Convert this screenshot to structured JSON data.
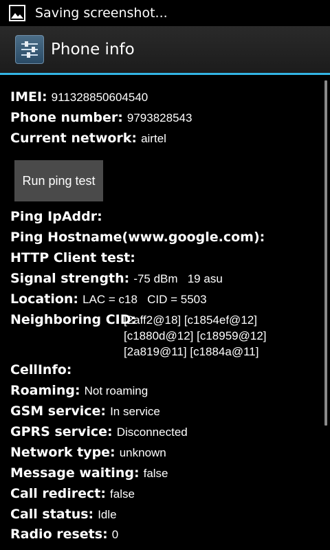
{
  "status_bar": {
    "icon": "image-icon",
    "text": "Saving screenshot..."
  },
  "action_bar": {
    "icon": "settings-sliders-icon",
    "title": "Phone info"
  },
  "info": {
    "imei": {
      "label": "IMEI:",
      "value": "911328850604540"
    },
    "phone_number": {
      "label": "Phone number:",
      "value": "9793828543"
    },
    "current_network": {
      "label": "Current network:",
      "value": "airtel"
    },
    "run_ping_test": "Run ping test",
    "ping_ipaddr": {
      "label": "Ping IpAddr:"
    },
    "ping_hostname": {
      "label": "Ping Hostname(www.google.com):"
    },
    "http_client_test": {
      "label": "HTTP Client test:"
    },
    "signal_strength": {
      "label": "Signal strength:",
      "value": "-75 dBm   19 asu"
    },
    "location": {
      "label": "Location:",
      "value": "LAC = c18   CID = 5503"
    },
    "neighboring_cid": {
      "label": "Neighboring CID:",
      "lines": [
        "[2aff2@18] [c1854ef@12]",
        "[c1880d@12] [c18959@12]",
        "[2a819@11] [c1884a@11]"
      ]
    },
    "cellinfo": {
      "label": "CellInfo:"
    },
    "roaming": {
      "label": "Roaming:",
      "value": "Not roaming"
    },
    "gsm_service": {
      "label": "GSM service:",
      "value": "In service"
    },
    "gprs_service": {
      "label": "GPRS service:",
      "value": "Disconnected"
    },
    "network_type": {
      "label": "Network type:",
      "value": "unknown"
    },
    "message_waiting": {
      "label": "Message waiting:",
      "value": "false"
    },
    "call_redirect": {
      "label": "Call redirect:",
      "value": "false"
    },
    "call_status": {
      "label": "Call status:",
      "value": "Idle"
    },
    "radio_resets": {
      "label": "Radio resets:",
      "value": "0"
    }
  },
  "colors": {
    "accent": "#33b5e5",
    "background": "#000000",
    "button": "#4a4a4a"
  }
}
